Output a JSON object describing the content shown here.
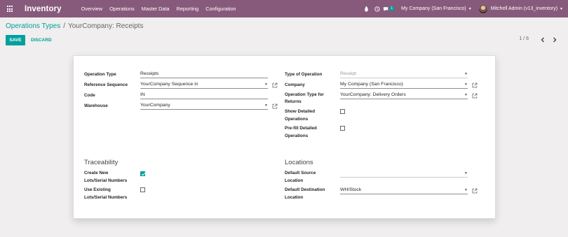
{
  "app": {
    "name": "Inventory"
  },
  "menu": [
    "Overview",
    "Operations",
    "Master Data",
    "Reporting",
    "Configuration"
  ],
  "navbar": {
    "chat_badge": "1",
    "company": "My Company (San Francisco)",
    "user": "Mitchell Admin (v13_inventory)"
  },
  "breadcrumb": {
    "parent": "Operations Types",
    "separator": "/",
    "current": "YourCompany: Receipts"
  },
  "buttons": {
    "save": "SAVE",
    "discard": "DISCARD"
  },
  "pager": {
    "value": "1 / 6"
  },
  "form": {
    "operation_type": {
      "label": "Operation Type",
      "value": "Receipts"
    },
    "reference_sequence": {
      "label": "Reference Sequence",
      "value": "YourCompany Sequence in"
    },
    "code": {
      "label": "Code",
      "value": "IN"
    },
    "warehouse": {
      "label": "Warehouse",
      "value": "YourCompany"
    },
    "type_of_operation": {
      "label": "Type of Operation",
      "value": "Receipt"
    },
    "company": {
      "label": "Company",
      "value": "My Company (San Francisco)"
    },
    "return_type": {
      "label_line1": "Operation Type for",
      "label_line2": "Returns",
      "value": "YourCompany: Delivery Orders"
    },
    "show_detailed": {
      "label_line1": "Show Detailed",
      "label_line2": "Operations",
      "checked": false
    },
    "prefill_detailed": {
      "label_line1": "Pre-fill Detailed",
      "label_line2": "Operations",
      "checked": false
    }
  },
  "traceability": {
    "title": "Traceability",
    "create_lots": {
      "label_line1": "Create New",
      "label_line2": "Lots/Serial Numbers",
      "checked": true
    },
    "use_existing": {
      "label_line1": "Use Existing",
      "label_line2": "Lots/Serial Numbers",
      "checked": false
    }
  },
  "locations": {
    "title": "Locations",
    "default_source": {
      "label_line1": "Default Source",
      "label_line2": "Location",
      "value": ""
    },
    "default_destination": {
      "label_line1": "Default Destination",
      "label_line2": "Location",
      "value": "WH/Stock"
    }
  },
  "colors": {
    "navbar": "#875a7b",
    "primary": "#00a09d"
  }
}
